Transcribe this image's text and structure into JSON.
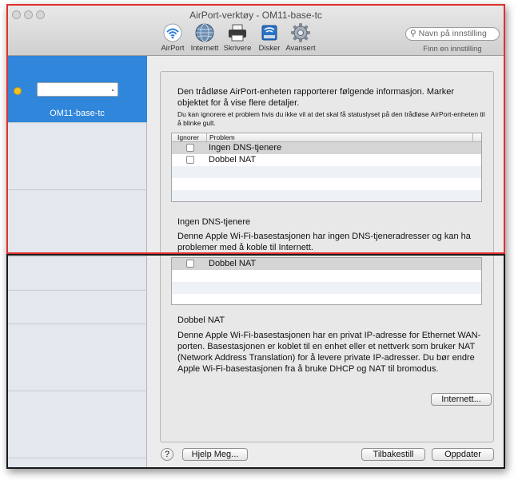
{
  "window": {
    "title": "AirPort-verktøy - OM11-base-tc"
  },
  "toolbar": {
    "items": [
      {
        "label": "AirPort",
        "icon": "wifi-icon"
      },
      {
        "label": "Internett",
        "icon": "globe-icon"
      },
      {
        "label": "Skrivere",
        "icon": "printer-icon"
      },
      {
        "label": "Disker",
        "icon": "disk-icon"
      },
      {
        "label": "Avansert",
        "icon": "gear-icon"
      }
    ],
    "search_placeholder": "Navn på innstilling",
    "search_hint": "Finn en innstilling"
  },
  "sidebar": {
    "device_name": "OM11-base-tc",
    "status_color": "#f2c11d",
    "selected_color": "#2f86da"
  },
  "main": {
    "intro": "Den trådløse AirPort-enheten rapporterer følgende informasjon. Marker objektet for å vise flere detaljer.",
    "intro_small": "Du kan ignorere et problem hvis du ikke vil at det skal få statuslyset på den trådløse AirPort-enheten til å blinke gult.",
    "table": {
      "columns": [
        "Ignorer",
        "Problem"
      ],
      "rows": [
        "Ingen DNS-tjenere",
        "Dobbel NAT"
      ]
    },
    "dns_section": {
      "title": "Ingen DNS-tjenere",
      "body": "Denne Apple Wi-Fi-basestasjonen har ingen DNS-tjeneradresser og kan ha problemer med å koble til Internett."
    },
    "table_bottom_row": "Dobbel NAT",
    "nat_section": {
      "title": "Dobbel NAT",
      "body": "Denne Apple Wi-Fi-basestasjonen har en privat IP-adresse for Ethernet WAN-porten. Basestasjonen er koblet til en enhet eller et nettverk som bruker NAT (Network Address Translation) for å levere private IP-adresser. Du bør endre Apple Wi-Fi-basestasjonen fra å bruke DHCP og NAT til bromodus.",
      "button": "Internett..."
    }
  },
  "footer": {
    "help_label": "?",
    "help_button": "Hjelp Meg...",
    "reset_button": "Tilbakestill",
    "update_button": "Oppdater"
  }
}
